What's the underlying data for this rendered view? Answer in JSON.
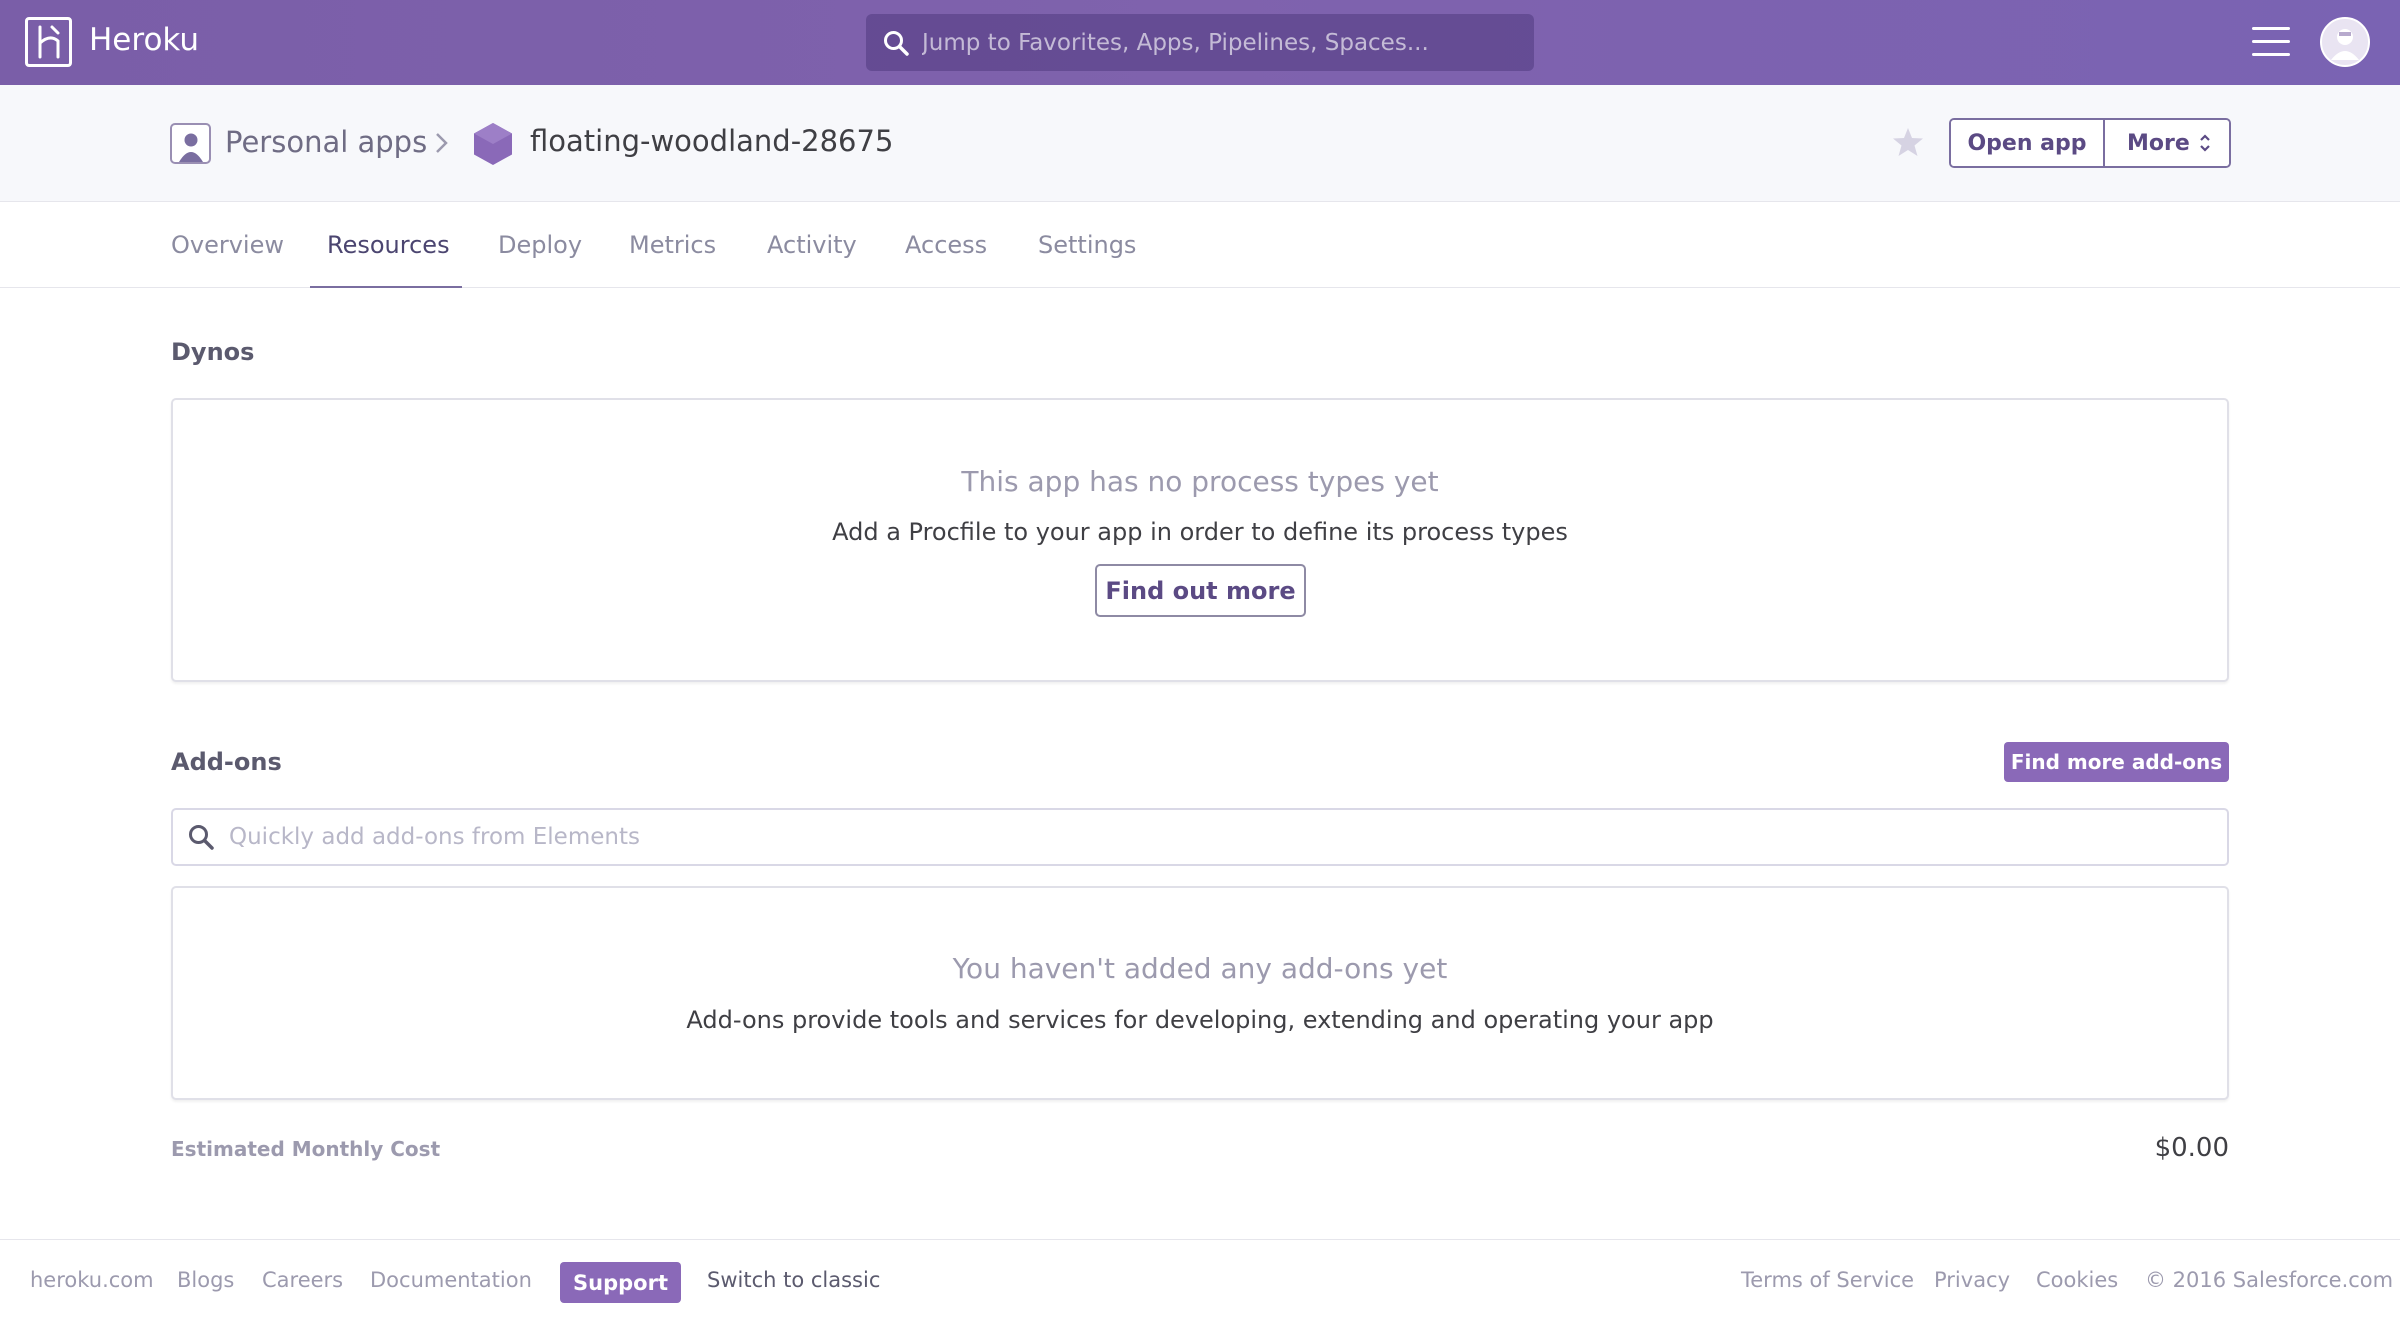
{
  "topbar": {
    "brand": "Heroku",
    "search_placeholder": "Jump to Favorites, Apps, Pipelines, Spaces...",
    "logo_icon": "heroku-logo-icon",
    "menu_icon": "hamburger-icon",
    "avatar_icon": "avatar-icon"
  },
  "breadcrumb": {
    "parent": "Personal apps",
    "app_name": "floating-woodland-28675"
  },
  "actions": {
    "open_app": "Open app",
    "more": "More"
  },
  "tabs": [
    {
      "label": "Overview",
      "active": false
    },
    {
      "label": "Resources",
      "active": true
    },
    {
      "label": "Deploy",
      "active": false
    },
    {
      "label": "Metrics",
      "active": false
    },
    {
      "label": "Activity",
      "active": false
    },
    {
      "label": "Access",
      "active": false
    },
    {
      "label": "Settings",
      "active": false
    }
  ],
  "dynos": {
    "title": "Dynos",
    "empty_heading": "This app has no process types yet",
    "empty_text": "Add a Procfile to your app in order to define its process types",
    "button": "Find out more"
  },
  "addons": {
    "title": "Add-ons",
    "find_button": "Find more add-ons",
    "search_placeholder": "Quickly add add-ons from Elements",
    "empty_heading": "You haven't added any add-ons yet",
    "empty_text": "Add-ons provide tools and services for developing, extending and operating your app"
  },
  "cost": {
    "label": "Estimated Monthly Cost",
    "value": "$0.00"
  },
  "footer": {
    "links_left": [
      "heroku.com",
      "Blogs",
      "Careers",
      "Documentation"
    ],
    "support": "Support",
    "switch": "Switch to classic",
    "links_right": [
      "Terms of Service",
      "Privacy",
      "Cookies",
      "© 2016 Salesforce.com"
    ]
  },
  "colors": {
    "brand_purple": "#7f62ad",
    "accent_button": "#8a69b8"
  }
}
